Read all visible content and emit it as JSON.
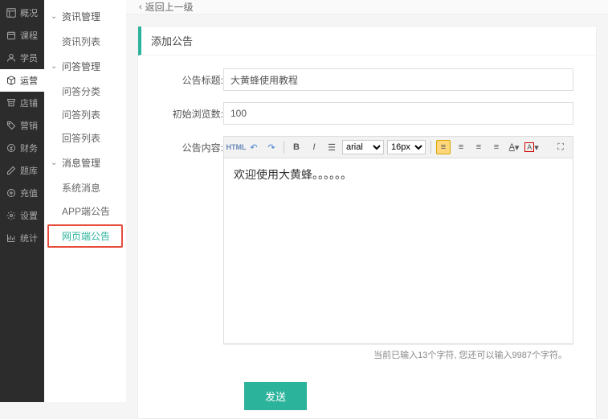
{
  "nav_dark": {
    "items": [
      {
        "label": "概况",
        "icon": "dashboard-icon",
        "active": false
      },
      {
        "label": "课程",
        "icon": "calendar-icon",
        "active": false
      },
      {
        "label": "学员",
        "icon": "user-icon",
        "active": false
      },
      {
        "label": "运营",
        "icon": "cube-icon",
        "active": true
      },
      {
        "label": "店铺",
        "icon": "shop-icon",
        "active": false
      },
      {
        "label": "营销",
        "icon": "tag-icon",
        "active": false
      },
      {
        "label": "财务",
        "icon": "money-icon",
        "active": false
      },
      {
        "label": "题库",
        "icon": "pencil-icon",
        "active": false
      },
      {
        "label": "充值",
        "icon": "plus-icon",
        "active": false
      },
      {
        "label": "设置",
        "icon": "gear-icon",
        "active": false
      },
      {
        "label": "统计",
        "icon": "chart-icon",
        "active": false
      }
    ]
  },
  "nav_light": {
    "groups": [
      {
        "label": "资讯管理",
        "items": [
          "资讯列表"
        ]
      },
      {
        "label": "问答管理",
        "items": [
          "问答分类",
          "问答列表",
          "回答列表"
        ]
      },
      {
        "label": "消息管理",
        "items": [
          "系统消息",
          "APP端公告",
          "网页端公告"
        ]
      }
    ],
    "active_sub": "网页端公告"
  },
  "topbar": {
    "back_label": "返回上一级"
  },
  "panel": {
    "title": "添加公告"
  },
  "form": {
    "title_label": "公告标题:",
    "title_value": "大黄蜂使用教程",
    "views_label": "初始浏览数:",
    "views_value": "100",
    "content_label": "公告内容:",
    "editor_body": "欢迎使用大黄蜂。。。。。。",
    "char_count": "当前已输入13个字符, 您还可以输入9987个字符。",
    "send_label": "发送"
  },
  "editor_toolbar": {
    "html_btn": "HTML",
    "font_family": "arial",
    "font_size": "16px"
  }
}
